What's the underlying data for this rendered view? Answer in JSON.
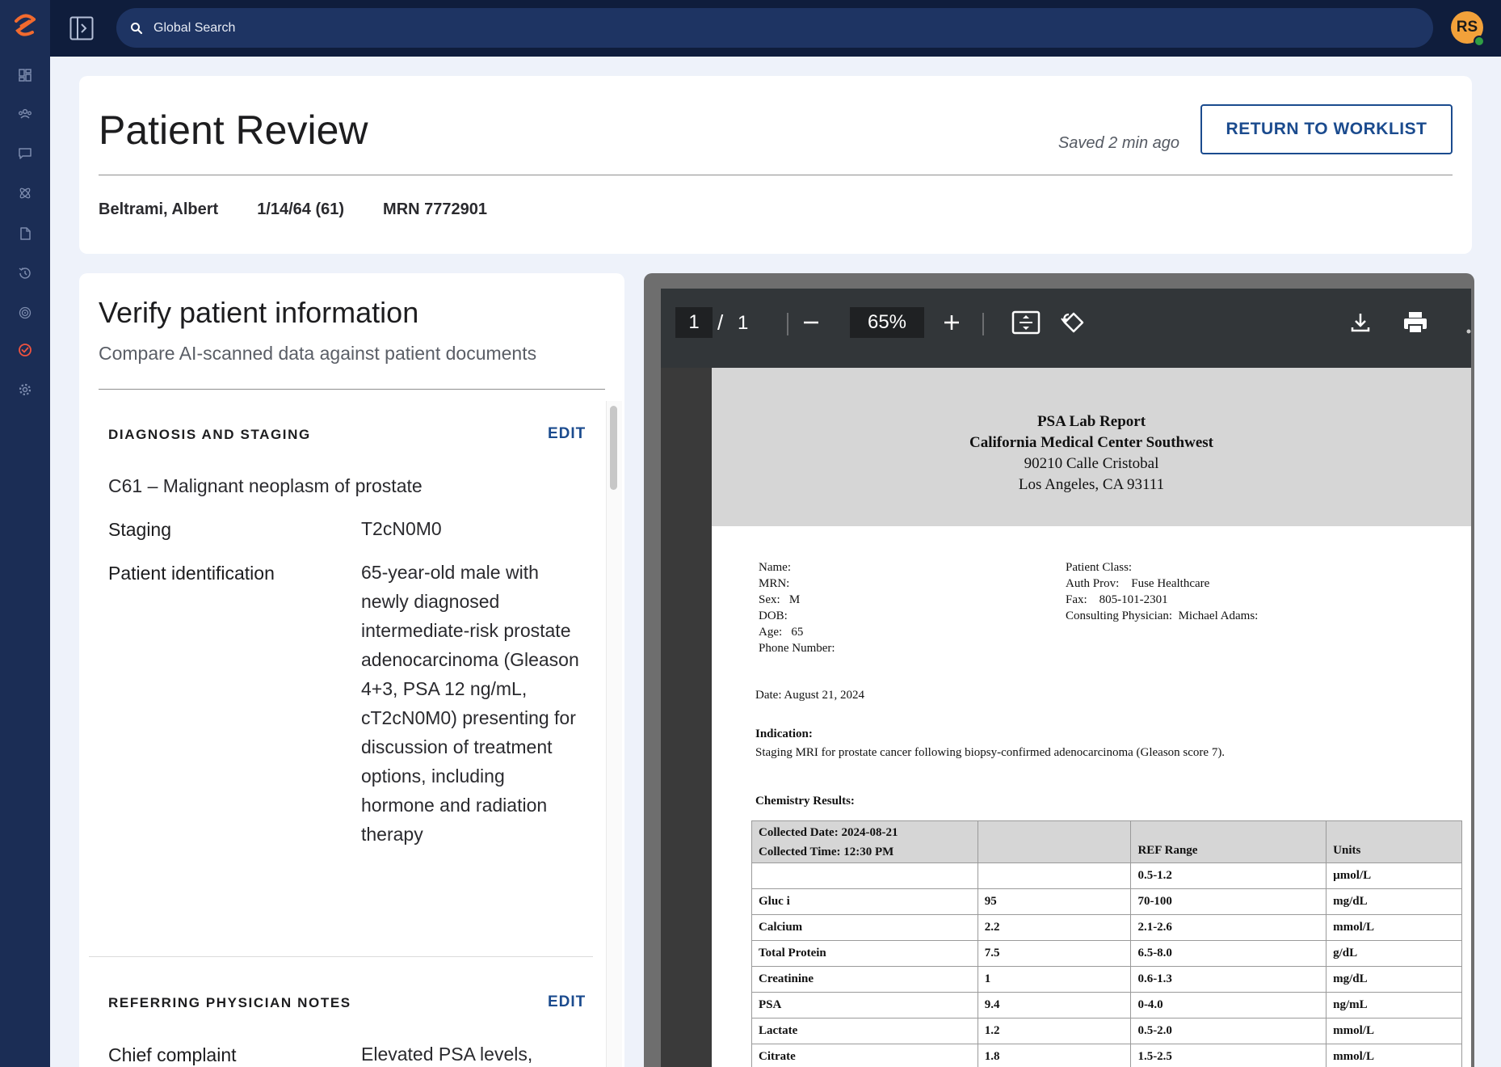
{
  "search": {
    "placeholder": "Global Search"
  },
  "user": {
    "initials": "RS"
  },
  "sidebar": {
    "icons": [
      "dashboard-icon",
      "patients-icon",
      "chat-icon",
      "research-icon",
      "document-icon",
      "history-icon",
      "radar-icon",
      "review-check-icon",
      "settings-icon"
    ],
    "active": "review-check-icon"
  },
  "header": {
    "title": "Patient Review",
    "saved_status": "Saved 2 min ago",
    "return_label": "RETURN TO WORKLIST",
    "patient_name": "Beltrami, Albert",
    "dob_age": "1/14/64 (61)",
    "mrn": "MRN 7772901"
  },
  "verify": {
    "title": "Verify patient information",
    "subtitle": "Compare AI-scanned data against patient documents",
    "sections": [
      {
        "heading": "DIAGNOSIS AND STAGING",
        "edit_label": "EDIT",
        "diagnosis": "C61 – Malignant neoplasm of prostate",
        "fields": [
          {
            "label": "Staging",
            "value": "T2cN0M0"
          },
          {
            "label": "Patient identification",
            "value": "65-year-old male with newly diagnosed intermediate-risk prostate adenocarcinoma (Gleason 4+3, PSA 12 ng/mL, cT2cN0M0) presenting for discussion of treatment options, including hormone and radiation therapy"
          }
        ]
      },
      {
        "heading": "REFERRING PHYSICIAN NOTES",
        "edit_label": "EDIT",
        "fields": [
          {
            "label": "Chief complaint",
            "value": "Elevated PSA levels,"
          }
        ]
      }
    ]
  },
  "pdf_viewer": {
    "page": "1",
    "total_pages": "1",
    "zoom": "65%",
    "document": {
      "title": "PSA Lab Report",
      "facility": "California Medical Center Southwest",
      "address_line1": "90210 Calle Cristobal",
      "address_line2": "Los Angeles, CA 93111",
      "left_fields": [
        "Name:",
        "MRN:",
        "Sex:   M",
        "DOB:",
        "Age:   65",
        "Phone Number:"
      ],
      "right_fields": [
        "Patient Class:",
        "Auth Prov:    Fuse Healthcare",
        "Fax:    805-101-2301",
        "Consulting Physician:  Michael Adams:"
      ],
      "date": "Date: August 21, 2024",
      "indication_label": "Indication:",
      "indication_text": "Staging MRI for prostate cancer following biopsy-confirmed adenocarcinoma (Gleason score 7).",
      "chemistry_label": "Chemistry Results:",
      "collected_date": "Collected Date: 2024-08-21",
      "collected_time": "Collected Time: 12:30 PM",
      "columns": [
        "",
        "",
        "REF Range",
        "Units"
      ],
      "rows": [
        [
          "",
          "",
          "0.5-1.2",
          "µmol/L"
        ],
        [
          "Gluc i",
          "95",
          "70-100",
          "mg/dL"
        ],
        [
          "Calcium",
          "2.2",
          "2.1-2.6",
          "mmol/L"
        ],
        [
          "Total Protein",
          "7.5",
          "6.5-8.0",
          "g/dL"
        ],
        [
          "Creatinine",
          "1",
          "0.6-1.3",
          "mg/dL"
        ],
        [
          "PSA",
          "9.4",
          "0-4.0",
          "ng/mL"
        ],
        [
          "Lactate",
          "1.2",
          "0.5-2.0",
          "mmol/L"
        ],
        [
          "Citrate",
          "1.8",
          "1.5-2.5",
          "mmol/L"
        ]
      ]
    }
  },
  "colors": {
    "sidebar_bg": "#1b2d55",
    "topbar_bg": "#0f1d3c",
    "accent": "#1b4b8e",
    "brand_orange": "#f26a2e",
    "avatar_bg": "#f2a13a",
    "active_icon": "#f0533f"
  }
}
